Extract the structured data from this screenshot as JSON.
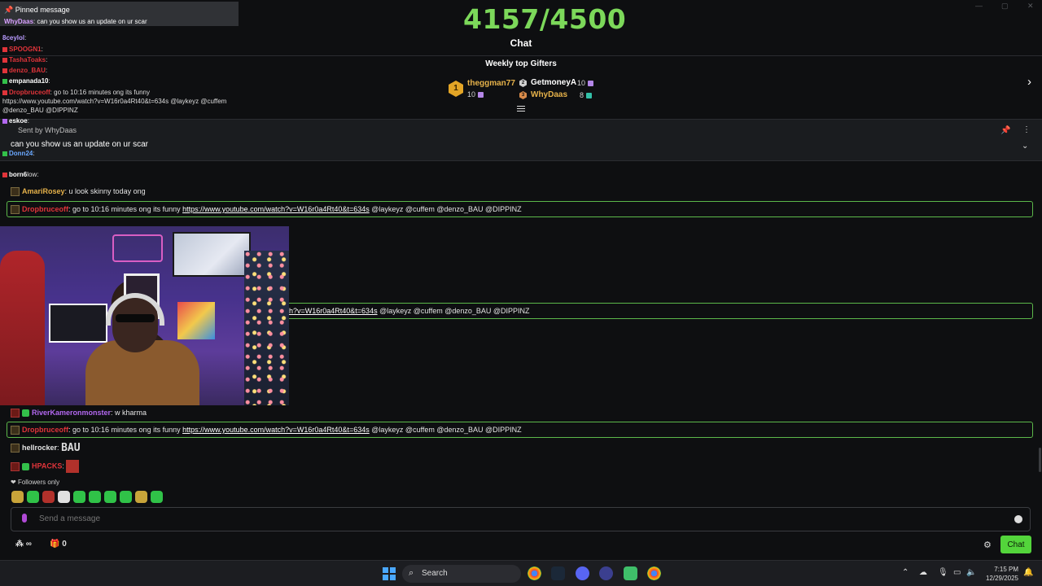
{
  "goal": {
    "text": "4157/4500"
  },
  "header": {
    "title": "Chat"
  },
  "gifters": {
    "title": "Weekly top Gifters",
    "first": {
      "rank": "1",
      "name": "theggman77",
      "count": "10"
    },
    "second": {
      "name": "GetmoneyA",
      "count": "10"
    },
    "third": {
      "name": "WhyDaas",
      "count": "8"
    }
  },
  "pinned": {
    "sent_by": "Sent by WhyDaas",
    "message": "can you show us an update on ur scar"
  },
  "overlay": {
    "pin_title": "Pinned message",
    "pin_user": "WhyDaas",
    "pin_text": ": can you show us an update on ur scar",
    "lines": [
      {
        "user": "8ceylol",
        "text": ":"
      },
      {
        "user": "SPOOGN1",
        "text": ":"
      },
      {
        "user": "TashaToaks",
        "text": ":"
      },
      {
        "user": "denzo_BAU",
        "text": ":"
      },
      {
        "user": "empanada10",
        "text": ":"
      },
      {
        "user": "Dropbruceoff",
        "text": ": go to 10:16 minutes ong its funny"
      },
      {
        "user": "",
        "text": "https://www.youtube.com/watch?v=W16r0a4Rt40&t=634s @laykeyz @cuffem"
      },
      {
        "user": "",
        "text": "@denzo_BAU @DIPPINZ"
      },
      {
        "user": "eskoe",
        "text": ":"
      },
      {
        "user": "Donn24",
        "text": ":"
      },
      {
        "user": "born6",
        "text": "low:"
      }
    ]
  },
  "messages": {
    "m1": {
      "user": "AmariRosey",
      "text": ": u look skinny today ong"
    },
    "hl1": {
      "user": "Dropbruceoff",
      "pre": ": go to 10:16 minutes ong its funny ",
      "link": "https://www.youtube.com/watch?v=W16r0a4Rt40&t=634s",
      "post": " @laykeyz @cuffem @denzo_BAU @DIPPINZ"
    },
    "hl2": {
      "link_tail": "h?v=W16r0a4Rt40&t=634s",
      "post": " @laykeyz @cuffem @denzo_BAU @DIPPINZ"
    },
    "m2": {
      "user": "RiverKameronmonster",
      "text": ": w kharma"
    },
    "hl3": {
      "user": "Dropbruceoff",
      "pre": ": go to 10:16 minutes ong its funny ",
      "link": "https://www.youtube.com/watch?v=W16r0a4Rt40&t=634s",
      "post": " @laykeyz @cuffem @denzo_BAU @DIPPINZ"
    },
    "m3": {
      "user": "hellrocker",
      "text": ":",
      "emote": "BAU"
    },
    "m4": {
      "user": "HPACKS",
      "text": ":"
    }
  },
  "footer": {
    "followers_only": "Followers only",
    "send_placeholder": "Send a message",
    "points": "∞",
    "gift_count": "0",
    "chat_button": "Chat"
  },
  "taskbar": {
    "search_label": "Search",
    "time": "7:15 PM",
    "date": "12/29/2025"
  },
  "colors": {
    "goal": "#7cd85a",
    "accent": "#53d43b",
    "highlight_border": "#5cb84a",
    "user_red": "#e0343a",
    "user_gold": "#e6b24a",
    "user_purple": "#b368f0"
  }
}
